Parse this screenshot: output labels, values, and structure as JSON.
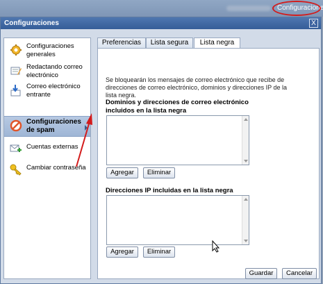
{
  "topbar": {
    "settings_link": "Configuraciones"
  },
  "dialog": {
    "title": "Configuraciones",
    "close_label": "X"
  },
  "sidebar": {
    "items": [
      {
        "label": "Configuraciones generales",
        "icon": "gear-icon"
      },
      {
        "label": "Redactando correo electrónico",
        "icon": "compose-icon"
      },
      {
        "label": "Correo electrónico entrante",
        "icon": "incoming-mail-icon"
      },
      {
        "label": "Configuraciones de spam",
        "icon": "no-spam-icon",
        "active": true
      },
      {
        "label": "Cuentas externas",
        "icon": "external-accounts-icon"
      },
      {
        "label": "Cambiar contraseña",
        "icon": "key-icon"
      }
    ]
  },
  "tabs": [
    {
      "label": "Preferencias"
    },
    {
      "label": "Lista segura"
    },
    {
      "label": "Lista negra",
      "active": true
    }
  ],
  "panel": {
    "description": "Se bloquearán los mensajes de correo electrónico que recibe de direcciones de correo electrónico, dominios y direcciones IP de la lista negra.",
    "domains_label": "Dominios y direcciones de correo electrónico incluidos en la lista negra",
    "domains_add": "Agregar",
    "domains_remove": "Eliminar",
    "ip_label": "Direcciones IP incluidas en la lista negra",
    "ip_add": "Agregar",
    "ip_remove": "Eliminar"
  },
  "footer": {
    "save": "Guardar",
    "cancel": "Cancelar"
  },
  "colors": {
    "titlebar": "#3f67a4",
    "annotation_red": "#d31b1b"
  }
}
